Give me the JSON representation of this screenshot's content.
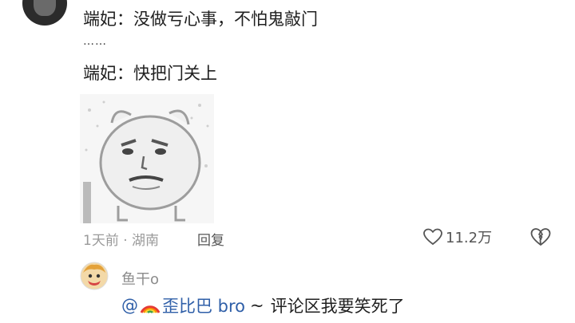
{
  "comment": {
    "line1": "端妃：没做亏心事，不怕鬼敲门",
    "dots": "……",
    "line2": "端妃：快把门关上",
    "meta": "1天前 · 湖南",
    "reply_label": "回复",
    "likes": "11.2万"
  },
  "reply": {
    "username": "鱼干o",
    "mention_prefix": "@",
    "mention_name": "歪比巴 bro",
    "separator": "~",
    "text": "评论区我要笑死了"
  },
  "icons": {
    "like": "heart-outline-icon",
    "dislike": "broken-heart-icon",
    "rainbow": "rainbow-emoji-icon"
  },
  "colors": {
    "mention": "#2f5fa8",
    "meta": "#9a9a9a"
  }
}
